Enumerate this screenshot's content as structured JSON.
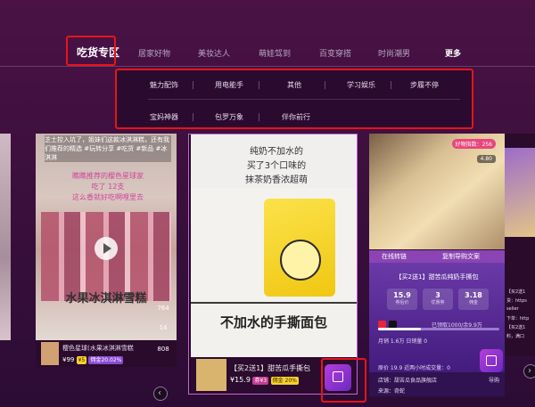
{
  "nav": {
    "tabs": [
      "吃货专区",
      "居家好物",
      "美妆达人",
      "萌娃驾到",
      "百变穿搭",
      "时尚潮男",
      "更多"
    ]
  },
  "dropdown": {
    "row1": [
      "魅力配饰",
      "用电能手",
      "其他",
      "学习娱乐",
      "步履不停"
    ],
    "row2": [
      "宝妈神器",
      "包罗万象",
      "伴你前行"
    ]
  },
  "card_a": {
    "caption": "芝士控入坑了，姐妹们这款冰淇淋糕，还有我们推荐的精选 #玩转分享 #吃货 #新品 #冰淇淋",
    "pink_lines": [
      "瞧瞧推荐的樱色星球家",
      "吃了 12支",
      "这么香就好吃啊哩里去"
    ],
    "big_title": "水果冰淇淋雪糕",
    "likes": "764",
    "comments": "14",
    "shares": "808",
    "product_title": "樱色星球(水果冰淇淋雪糕",
    "price": "¥99",
    "coupon": "¥5",
    "commission": "佣金20.02%"
  },
  "card_b": {
    "headline": [
      "纯奶不加水的",
      "买了3个口味的",
      "抹茶奶香浓超萌"
    ],
    "mid_title": "不加水的手撕面包",
    "product_title": "【买2送1】甜苦瓜手撕包",
    "price": "¥15.9",
    "coupon": "券¥3",
    "commission": "佣金 20%"
  },
  "card_c": {
    "heat_label": "好物指数：256",
    "rating": "4.80",
    "tabs": [
      "在线转链",
      "复制导购文案"
    ],
    "product_title": "【买2送1】甜苦瓜纯奶手撕包",
    "stats": [
      {
        "value": "15.9",
        "label": "券后价"
      },
      {
        "value": "3",
        "label": "优惠券"
      },
      {
        "value": "3.18",
        "label": "佣金"
      }
    ],
    "sold_label": "已领取1000/余9.9万",
    "progress": 0.35,
    "monthly": "月销 1.6万  日销量 0",
    "footer_lines": [
      "原价 19.9  近两小时成交量：0",
      "店铺：甜苦瓜食品旗舰店",
      "来源：奇蛇"
    ],
    "action_label": "导购"
  },
  "card_d": {
    "lines": [
      "【买2送1",
      "货：https",
      "seller",
      "下单：http",
      "【买2送1",
      "料，满口"
    ]
  }
}
